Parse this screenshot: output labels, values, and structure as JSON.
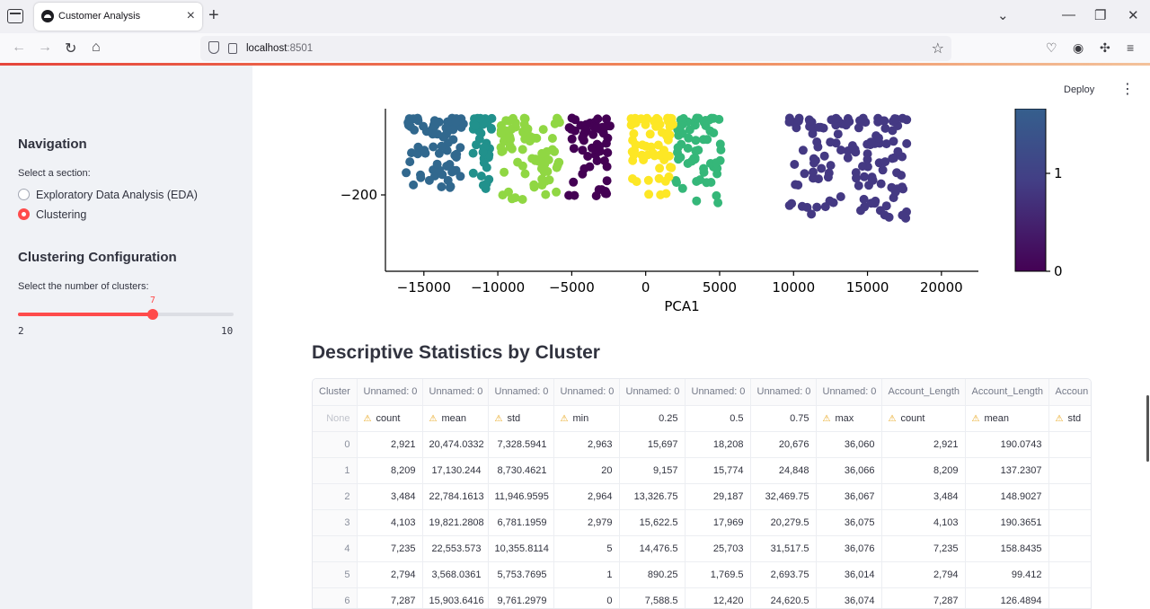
{
  "browser": {
    "tab_title": "Customer Analysis",
    "url_host": "localhost",
    "url_port": ":8501"
  },
  "toolbar": {
    "deploy_label": "Deploy"
  },
  "sidebar": {
    "navigation_heading": "Navigation",
    "section_label": "Select a section:",
    "options": [
      {
        "label": "Exploratory Data Analysis (EDA)",
        "selected": false
      },
      {
        "label": "Clustering",
        "selected": true
      }
    ],
    "config_heading": "Clustering Configuration",
    "slider_label": "Select the number of clusters:",
    "slider_value": 7,
    "slider_min": 2,
    "slider_max": 10
  },
  "chart_data": {
    "type": "scatter",
    "xlabel": "PCA1",
    "x_ticks": [
      "−15000",
      "−10000",
      "−5000",
      "0",
      "5000",
      "10000",
      "15000",
      "20000"
    ],
    "y_ticks": [
      "−200"
    ],
    "xlim": [
      -17600,
      22500
    ],
    "colorbar": {
      "ticks": [
        "1",
        "0"
      ],
      "colormap": "viridis"
    },
    "clusters": [
      {
        "cluster": 0,
        "color": "#440154",
        "x_range": [
          -5200,
          -2400
        ],
        "y_range": [
          -214,
          -105
        ]
      },
      {
        "cluster": 1,
        "color": "#443983",
        "x_range": [
          9700,
          17700
        ],
        "y_range": [
          -230,
          -105
        ]
      },
      {
        "cluster": 2,
        "color": "#31688e",
        "x_range": [
          -16200,
          -12300
        ],
        "y_range": [
          -195,
          -105
        ]
      },
      {
        "cluster": 3,
        "color": "#21918c",
        "x_range": [
          -11800,
          -10400
        ],
        "y_range": [
          -195,
          -105
        ]
      },
      {
        "cluster": 4,
        "color": "#35b779",
        "x_range": [
          2000,
          5100
        ],
        "y_range": [
          -210,
          -105
        ]
      },
      {
        "cluster": 5,
        "color": "#90d743",
        "x_range": [
          -9800,
          -5700
        ],
        "y_range": [
          -210,
          -105
        ]
      },
      {
        "cluster": 6,
        "color": "#fde725",
        "x_range": [
          -1000,
          1900
        ],
        "y_range": [
          -205,
          -105
        ]
      }
    ]
  },
  "stats": {
    "title": "Descriptive Statistics by Cluster",
    "header_row1": [
      "Cluster",
      "Unnamed: 0",
      "Unnamed: 0",
      "Unnamed: 0",
      "Unnamed: 0",
      "Unnamed: 0",
      "Unnamed: 0",
      "Unnamed: 0",
      "Unnamed: 0",
      "Account_Length",
      "Account_Length",
      "Accoun"
    ],
    "header_row2": [
      {
        "text": "None",
        "warn": false
      },
      {
        "text": "count",
        "warn": true
      },
      {
        "text": "mean",
        "warn": true
      },
      {
        "text": "std",
        "warn": true
      },
      {
        "text": "min",
        "warn": true
      },
      {
        "text": "0.25",
        "warn": false
      },
      {
        "text": "0.5",
        "warn": false
      },
      {
        "text": "0.75",
        "warn": false
      },
      {
        "text": "max",
        "warn": true
      },
      {
        "text": "count",
        "warn": true
      },
      {
        "text": "mean",
        "warn": true
      },
      {
        "text": "std",
        "warn": true
      }
    ],
    "rows": [
      [
        "0",
        "2,921",
        "20,474.0332",
        "7,328.5941",
        "2,963",
        "15,697",
        "18,208",
        "20,676",
        "36,060",
        "2,921",
        "190.0743",
        ""
      ],
      [
        "1",
        "8,209",
        "17,130.244",
        "8,730.4621",
        "20",
        "9,157",
        "15,774",
        "24,848",
        "36,066",
        "8,209",
        "137.2307",
        ""
      ],
      [
        "2",
        "3,484",
        "22,784.1613",
        "11,946.9595",
        "2,964",
        "13,326.75",
        "29,187",
        "32,469.75",
        "36,067",
        "3,484",
        "148.9027",
        ""
      ],
      [
        "3",
        "4,103",
        "19,821.2808",
        "6,781.1959",
        "2,979",
        "15,622.5",
        "17,969",
        "20,279.5",
        "36,075",
        "4,103",
        "190.3651",
        ""
      ],
      [
        "4",
        "7,235",
        "22,553.573",
        "10,355.8114",
        "5",
        "14,476.5",
        "25,703",
        "31,517.5",
        "36,076",
        "7,235",
        "158.8435",
        ""
      ],
      [
        "5",
        "2,794",
        "3,568.0361",
        "5,753.7695",
        "1",
        "890.25",
        "1,769.5",
        "2,693.75",
        "36,014",
        "2,794",
        "99.412",
        ""
      ],
      [
        "6",
        "7,287",
        "15,903.6416",
        "9,761.2979",
        "0",
        "7,588.5",
        "12,420",
        "24,620.5",
        "36,074",
        "7,287",
        "126.4894",
        ""
      ]
    ]
  }
}
